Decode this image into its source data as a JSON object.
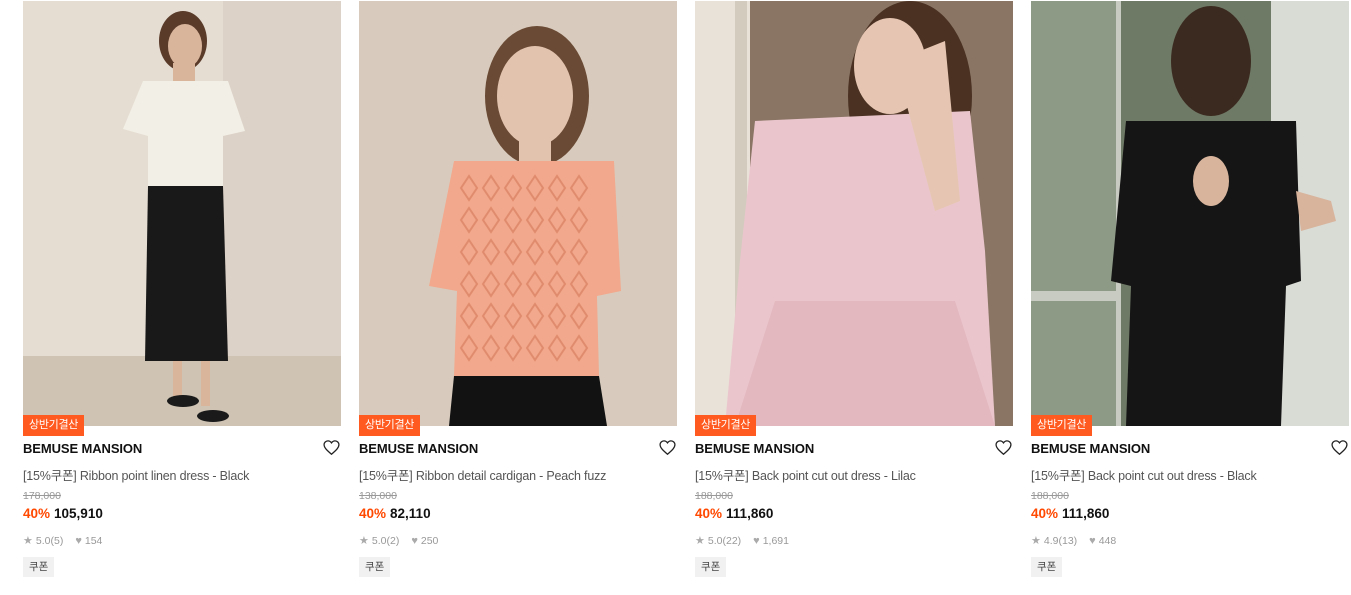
{
  "products": [
    {
      "badge": "상반기결산",
      "brand": "BEMUSE MANSION",
      "title": "[15%쿠폰] Ribbon point linen dress - Black",
      "original_price": "178,000",
      "discount": "40%",
      "price": "105,910",
      "rating": "5.0",
      "reviews": "(5)",
      "likes": "154",
      "coupon": "쿠폰",
      "colors": {
        "bg": "#e5ddd2",
        "bg2": "#d7ccbf",
        "floor": "#cfc4b4",
        "garment": "#f2efe6",
        "garment2": "#1a1919",
        "skin": "#d9b59c",
        "hair": "#5a3b2a"
      }
    },
    {
      "badge": "상반기결산",
      "brand": "BEMUSE MANSION",
      "title": "[15%쿠폰] Ribbon detail cardigan - Peach fuzz",
      "original_price": "138,000",
      "discount": "40%",
      "price": "82,110",
      "rating": "5.0",
      "reviews": "(2)",
      "likes": "250",
      "coupon": "쿠폰",
      "colors": {
        "bg": "#d8cbbd",
        "bg2": "#cdbfae",
        "floor": "#c9baa8",
        "garment": "#f2a88c",
        "garment2": "#121212",
        "skin": "#e2c3ad",
        "hair": "#6a4a34"
      }
    },
    {
      "badge": "상반기결산",
      "brand": "BEMUSE MANSION",
      "title": "[15%쿠폰] Back point cut out dress - Lilac",
      "original_price": "188,000",
      "discount": "40%",
      "price": "111,860",
      "rating": "5.0",
      "reviews": "(22)",
      "likes": "1,691",
      "coupon": "쿠폰",
      "colors": {
        "bg": "#b9a797",
        "bg2": "#8a7565",
        "floor": "#c6b6a6",
        "garment": "#eac6cc",
        "garment2": "#e3b8bf",
        "skin": "#e6c6b2",
        "hair": "#4a3122"
      }
    },
    {
      "badge": "상반기결산",
      "brand": "BEMUSE MANSION",
      "title": "[15%쿠폰] Back point cut out dress - Black",
      "original_price": "188,000",
      "discount": "40%",
      "price": "111,860",
      "rating": "4.9",
      "reviews": "(13)",
      "likes": "448",
      "coupon": "쿠폰",
      "colors": {
        "bg": "#8d9a86",
        "bg2": "#c7cbc1",
        "floor": "#6f7a66",
        "garment": "#151515",
        "garment2": "#0c0c0c",
        "skin": "#d8b49c",
        "hair": "#3b2a1f"
      }
    }
  ],
  "icons": {
    "like": "heart-outline-icon",
    "star": "star-icon",
    "likes": "heart-filled-icon"
  }
}
